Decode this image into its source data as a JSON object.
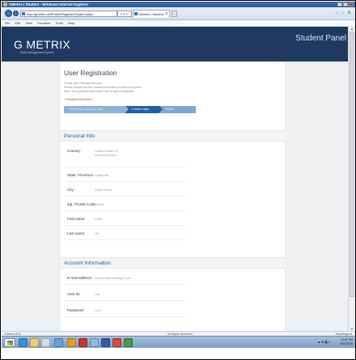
{
  "window": {
    "title": "GMetrix | Student - Windows Internet Explorer"
  },
  "browser": {
    "url": "http://gmetrix.net/Public/Register/Student.aspx",
    "search_tools": "P ▾ ↻",
    "tab_label": "GMetrix | Student",
    "tab_close": "x",
    "right_icons": "⌂ ☆ ⚙"
  },
  "menu": [
    "File",
    "Edit",
    "View",
    "Favorites",
    "Tools",
    "Help"
  ],
  "site": {
    "logo": "G METRIX",
    "logo_sub": "Skills Management System",
    "panel_title": "Student Panel"
  },
  "registration": {
    "heading": "User Registration",
    "intro_lines": [
      "Create your Personal Account.",
      "Please ensure that the contact information provided is correct.",
      "Note: Your personal information will be kept confidential."
    ],
    "required_note": "* Required information.",
    "steps": [
      "Enter your Account Data",
      "Confirm data",
      "Finish"
    ]
  },
  "personal_info": {
    "title": "Personal Info",
    "fields": [
      {
        "label": "Country:",
        "value": "United States of America (USA)"
      },
      {
        "label": "State / Province:",
        "value": "California"
      },
      {
        "label": "City:",
        "value": "Santa Rosa"
      },
      {
        "label": "Zip / Postal Code:",
        "value": "95403"
      },
      {
        "label": "First name:",
        "value": "Cindi"
      },
      {
        "label": "Last name:",
        "value": "Ott"
      }
    ]
  },
  "account_info": {
    "title": "Account Information",
    "fields": [
      {
        "label": "E-mail address:",
        "value": "cott@empirecollege.com"
      },
      {
        "label": "User ID:",
        "value": "cott"
      },
      {
        "label": "Password:",
        "value": "••••••"
      }
    ]
  },
  "statusbar": {
    "left": "GMetrix 2012",
    "center": "All Rights Reserved",
    "right": "Help/Support"
  },
  "taskbar": {
    "tray_icons": "▲ ⊞ ◧ ◐",
    "time": "12:41 PM",
    "date": "9/14/2016"
  },
  "colors": {
    "header_bg": "#1e3a60",
    "step_active": "#1f5fa8",
    "section_title": "#2d5b86",
    "required": "#c0392b"
  }
}
